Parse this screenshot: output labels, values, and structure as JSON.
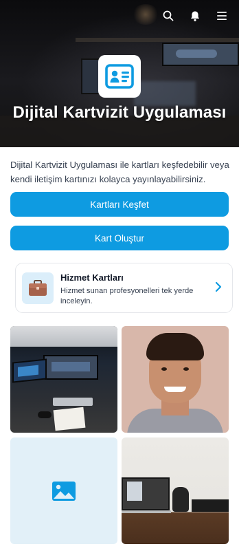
{
  "hero": {
    "title": "Dijital Kartvizit Uygulaması",
    "icons": [
      "search-icon",
      "bell-icon",
      "menu-icon"
    ]
  },
  "intro": {
    "text": "Dijital Kartvizit Uygulaması ile kartları keşfedebilir veya kendi iletişim kartınızı kolayca yayınlayabilirsiniz."
  },
  "buttons": {
    "explore_label": "Kartları Keşfet",
    "create_label": "Kart Oluştur"
  },
  "service_card": {
    "title": "Hizmet Kartları",
    "description": "Hizmet sunan profesyonelleri tek yerde inceleyin.",
    "icon": "briefcase-icon"
  },
  "gallery": {
    "tiles": [
      "desk-setup-photo",
      "portrait-photo",
      "image-placeholder",
      "workspace-photo"
    ]
  },
  "colors": {
    "accent": "#0e9be1",
    "placeholder_bg": "#e2f0f8"
  }
}
